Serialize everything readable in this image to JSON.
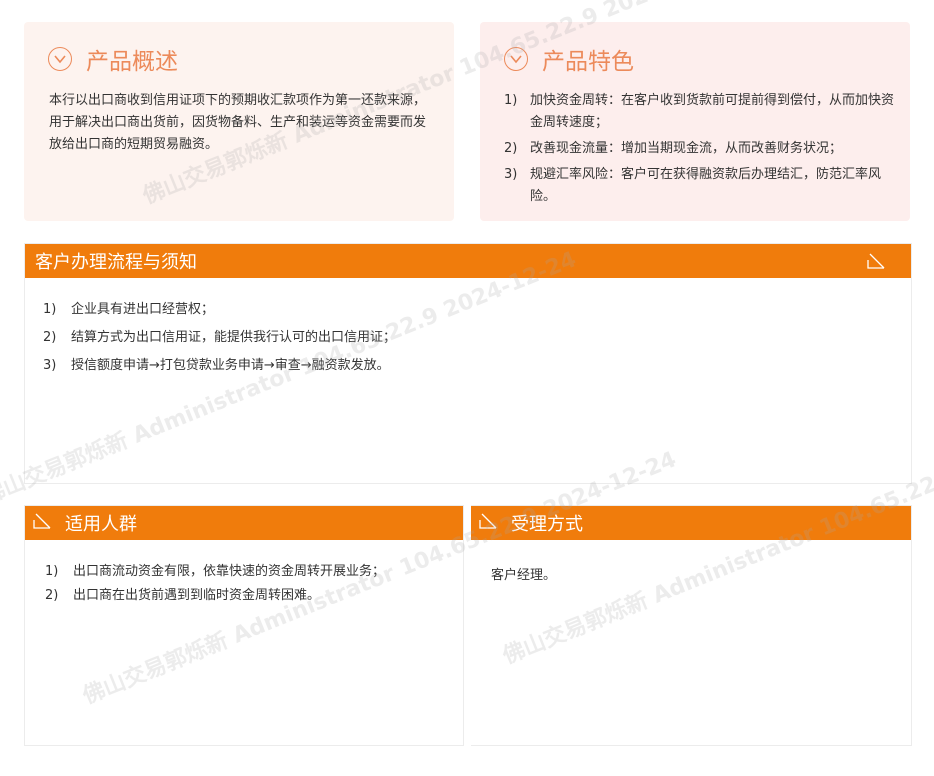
{
  "overview": {
    "title": "产品概述",
    "text": " 本行以出口商收到信用证项下的预期收汇款项作为第一还款来源，用于解决出口商出货前，因货物备料、生产和装运等资金需要而发放给出口商的短期贸易融资。"
  },
  "features": {
    "title": "产品特色",
    "items": [
      {
        "num": "1)",
        "text": "加快资金周转：在客户收到货款前可提前得到偿付，从而加快资金周转速度；"
      },
      {
        "num": "2)",
        "text": "改善现金流量：增加当期现金流，从而改善财务状况；"
      },
      {
        "num": "3)",
        "text": "规避汇率风险：客户可在获得融资款后办理结汇，防范汇率风险。"
      }
    ]
  },
  "process": {
    "title": "客户办理流程与须知",
    "items": [
      {
        "num": "1)",
        "text": "企业具有进出口经营权；"
      },
      {
        "num": "2)",
        "text": "结算方式为出口信用证，能提供我行认可的出口信用证；"
      },
      {
        "num": "3)",
        "text": "授信额度申请→打包贷款业务申请→审查→融资款发放。"
      }
    ]
  },
  "audience": {
    "title": "适用人群",
    "items": [
      {
        "num": "1)",
        "text": " 出口商流动资金有限，依靠快速的资金周转开展业务；"
      },
      {
        "num": "2)",
        "text": "出口商在出货前遇到到临时资金周转困难。"
      }
    ]
  },
  "acceptance": {
    "title": "受理方式",
    "text": "客户经理。"
  },
  "watermark": {
    "text": "佛山交易郭烁新  Administrator  104.65.22.9  2024-12-24"
  },
  "colors": {
    "accent": "#f07c0c",
    "title_orange": "#ec8a5a",
    "overview_bg": "#fdf3ef",
    "features_bg": "#fdeeed"
  },
  "icons": {
    "circle_chevron": "chevron-down-circle-icon",
    "corner_arrow": "arrow-down-right-icon"
  }
}
